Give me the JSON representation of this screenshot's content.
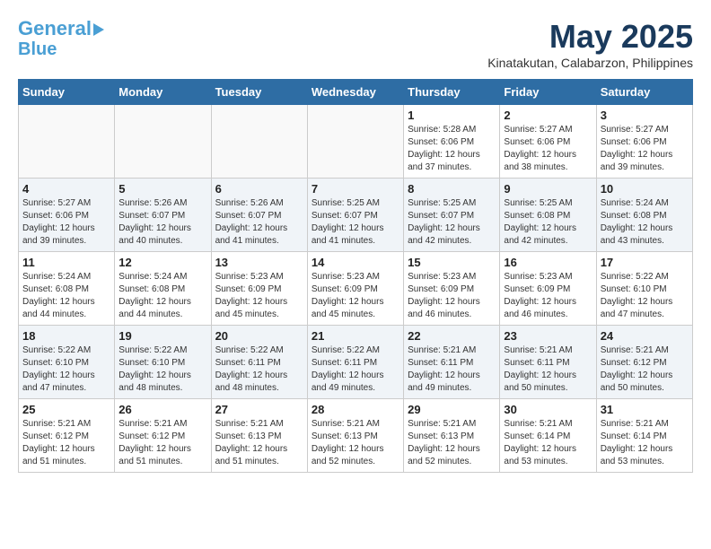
{
  "header": {
    "logo_line1": "General",
    "logo_line2": "Blue",
    "month": "May 2025",
    "location": "Kinatakutan, Calabarzon, Philippines"
  },
  "weekdays": [
    "Sunday",
    "Monday",
    "Tuesday",
    "Wednesday",
    "Thursday",
    "Friday",
    "Saturday"
  ],
  "weeks": [
    [
      {
        "day": "",
        "info": ""
      },
      {
        "day": "",
        "info": ""
      },
      {
        "day": "",
        "info": ""
      },
      {
        "day": "",
        "info": ""
      },
      {
        "day": "1",
        "info": "Sunrise: 5:28 AM\nSunset: 6:06 PM\nDaylight: 12 hours\nand 37 minutes."
      },
      {
        "day": "2",
        "info": "Sunrise: 5:27 AM\nSunset: 6:06 PM\nDaylight: 12 hours\nand 38 minutes."
      },
      {
        "day": "3",
        "info": "Sunrise: 5:27 AM\nSunset: 6:06 PM\nDaylight: 12 hours\nand 39 minutes."
      }
    ],
    [
      {
        "day": "4",
        "info": "Sunrise: 5:27 AM\nSunset: 6:06 PM\nDaylight: 12 hours\nand 39 minutes."
      },
      {
        "day": "5",
        "info": "Sunrise: 5:26 AM\nSunset: 6:07 PM\nDaylight: 12 hours\nand 40 minutes."
      },
      {
        "day": "6",
        "info": "Sunrise: 5:26 AM\nSunset: 6:07 PM\nDaylight: 12 hours\nand 41 minutes."
      },
      {
        "day": "7",
        "info": "Sunrise: 5:25 AM\nSunset: 6:07 PM\nDaylight: 12 hours\nand 41 minutes."
      },
      {
        "day": "8",
        "info": "Sunrise: 5:25 AM\nSunset: 6:07 PM\nDaylight: 12 hours\nand 42 minutes."
      },
      {
        "day": "9",
        "info": "Sunrise: 5:25 AM\nSunset: 6:08 PM\nDaylight: 12 hours\nand 42 minutes."
      },
      {
        "day": "10",
        "info": "Sunrise: 5:24 AM\nSunset: 6:08 PM\nDaylight: 12 hours\nand 43 minutes."
      }
    ],
    [
      {
        "day": "11",
        "info": "Sunrise: 5:24 AM\nSunset: 6:08 PM\nDaylight: 12 hours\nand 44 minutes."
      },
      {
        "day": "12",
        "info": "Sunrise: 5:24 AM\nSunset: 6:08 PM\nDaylight: 12 hours\nand 44 minutes."
      },
      {
        "day": "13",
        "info": "Sunrise: 5:23 AM\nSunset: 6:09 PM\nDaylight: 12 hours\nand 45 minutes."
      },
      {
        "day": "14",
        "info": "Sunrise: 5:23 AM\nSunset: 6:09 PM\nDaylight: 12 hours\nand 45 minutes."
      },
      {
        "day": "15",
        "info": "Sunrise: 5:23 AM\nSunset: 6:09 PM\nDaylight: 12 hours\nand 46 minutes."
      },
      {
        "day": "16",
        "info": "Sunrise: 5:23 AM\nSunset: 6:09 PM\nDaylight: 12 hours\nand 46 minutes."
      },
      {
        "day": "17",
        "info": "Sunrise: 5:22 AM\nSunset: 6:10 PM\nDaylight: 12 hours\nand 47 minutes."
      }
    ],
    [
      {
        "day": "18",
        "info": "Sunrise: 5:22 AM\nSunset: 6:10 PM\nDaylight: 12 hours\nand 47 minutes."
      },
      {
        "day": "19",
        "info": "Sunrise: 5:22 AM\nSunset: 6:10 PM\nDaylight: 12 hours\nand 48 minutes."
      },
      {
        "day": "20",
        "info": "Sunrise: 5:22 AM\nSunset: 6:11 PM\nDaylight: 12 hours\nand 48 minutes."
      },
      {
        "day": "21",
        "info": "Sunrise: 5:22 AM\nSunset: 6:11 PM\nDaylight: 12 hours\nand 49 minutes."
      },
      {
        "day": "22",
        "info": "Sunrise: 5:21 AM\nSunset: 6:11 PM\nDaylight: 12 hours\nand 49 minutes."
      },
      {
        "day": "23",
        "info": "Sunrise: 5:21 AM\nSunset: 6:11 PM\nDaylight: 12 hours\nand 50 minutes."
      },
      {
        "day": "24",
        "info": "Sunrise: 5:21 AM\nSunset: 6:12 PM\nDaylight: 12 hours\nand 50 minutes."
      }
    ],
    [
      {
        "day": "25",
        "info": "Sunrise: 5:21 AM\nSunset: 6:12 PM\nDaylight: 12 hours\nand 51 minutes."
      },
      {
        "day": "26",
        "info": "Sunrise: 5:21 AM\nSunset: 6:12 PM\nDaylight: 12 hours\nand 51 minutes."
      },
      {
        "day": "27",
        "info": "Sunrise: 5:21 AM\nSunset: 6:13 PM\nDaylight: 12 hours\nand 51 minutes."
      },
      {
        "day": "28",
        "info": "Sunrise: 5:21 AM\nSunset: 6:13 PM\nDaylight: 12 hours\nand 52 minutes."
      },
      {
        "day": "29",
        "info": "Sunrise: 5:21 AM\nSunset: 6:13 PM\nDaylight: 12 hours\nand 52 minutes."
      },
      {
        "day": "30",
        "info": "Sunrise: 5:21 AM\nSunset: 6:14 PM\nDaylight: 12 hours\nand 53 minutes."
      },
      {
        "day": "31",
        "info": "Sunrise: 5:21 AM\nSunset: 6:14 PM\nDaylight: 12 hours\nand 53 minutes."
      }
    ]
  ]
}
